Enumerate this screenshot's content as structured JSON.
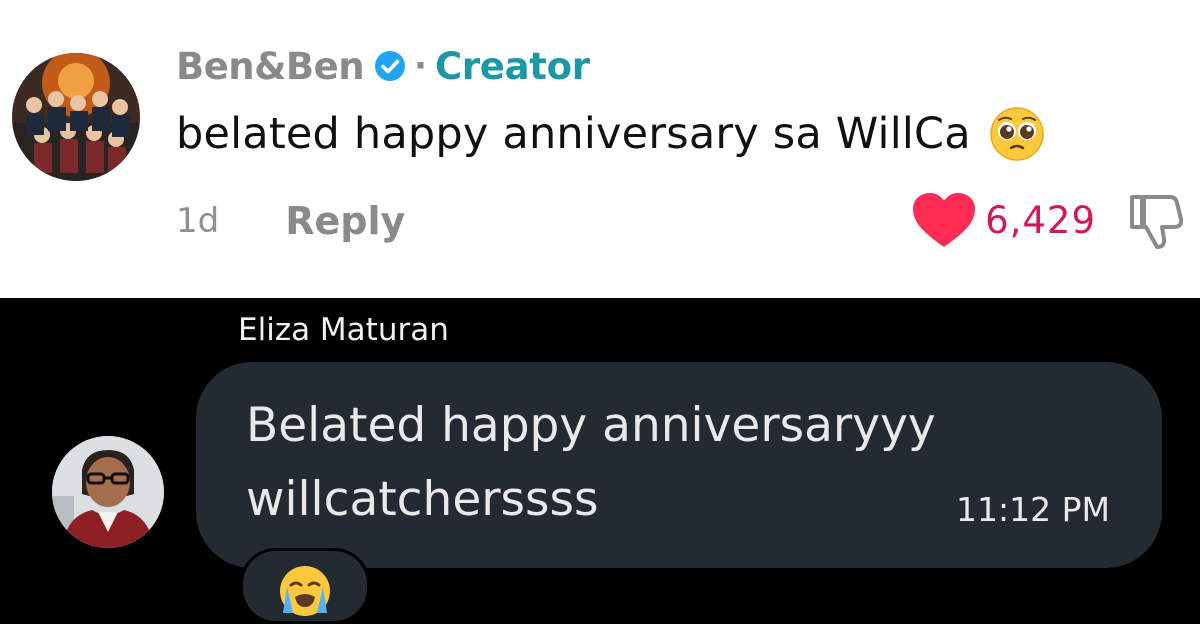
{
  "comment": {
    "username": "Ben&Ben",
    "separator": "·",
    "role_badge": "Creator",
    "text": "belated happy anniversary sa WillCa",
    "text_emoji": "pleading-face-icon",
    "time_ago": "1d",
    "reply_label": "Reply",
    "like_count": "6,429",
    "colors": {
      "creator": "#1b98a8",
      "like": "#fe2c55",
      "like_count": "#d4175a",
      "verified": "#20a4f3"
    }
  },
  "chat": {
    "sender_name": "Eliza Maturan",
    "message_line1": "Belated happy anniversaryyy",
    "message_line2": "willcatcherssss",
    "timestamp": "11:12 PM",
    "reaction": "loudly-crying-face-icon",
    "colors": {
      "bubble": "#242a31",
      "background": "#000000"
    }
  }
}
